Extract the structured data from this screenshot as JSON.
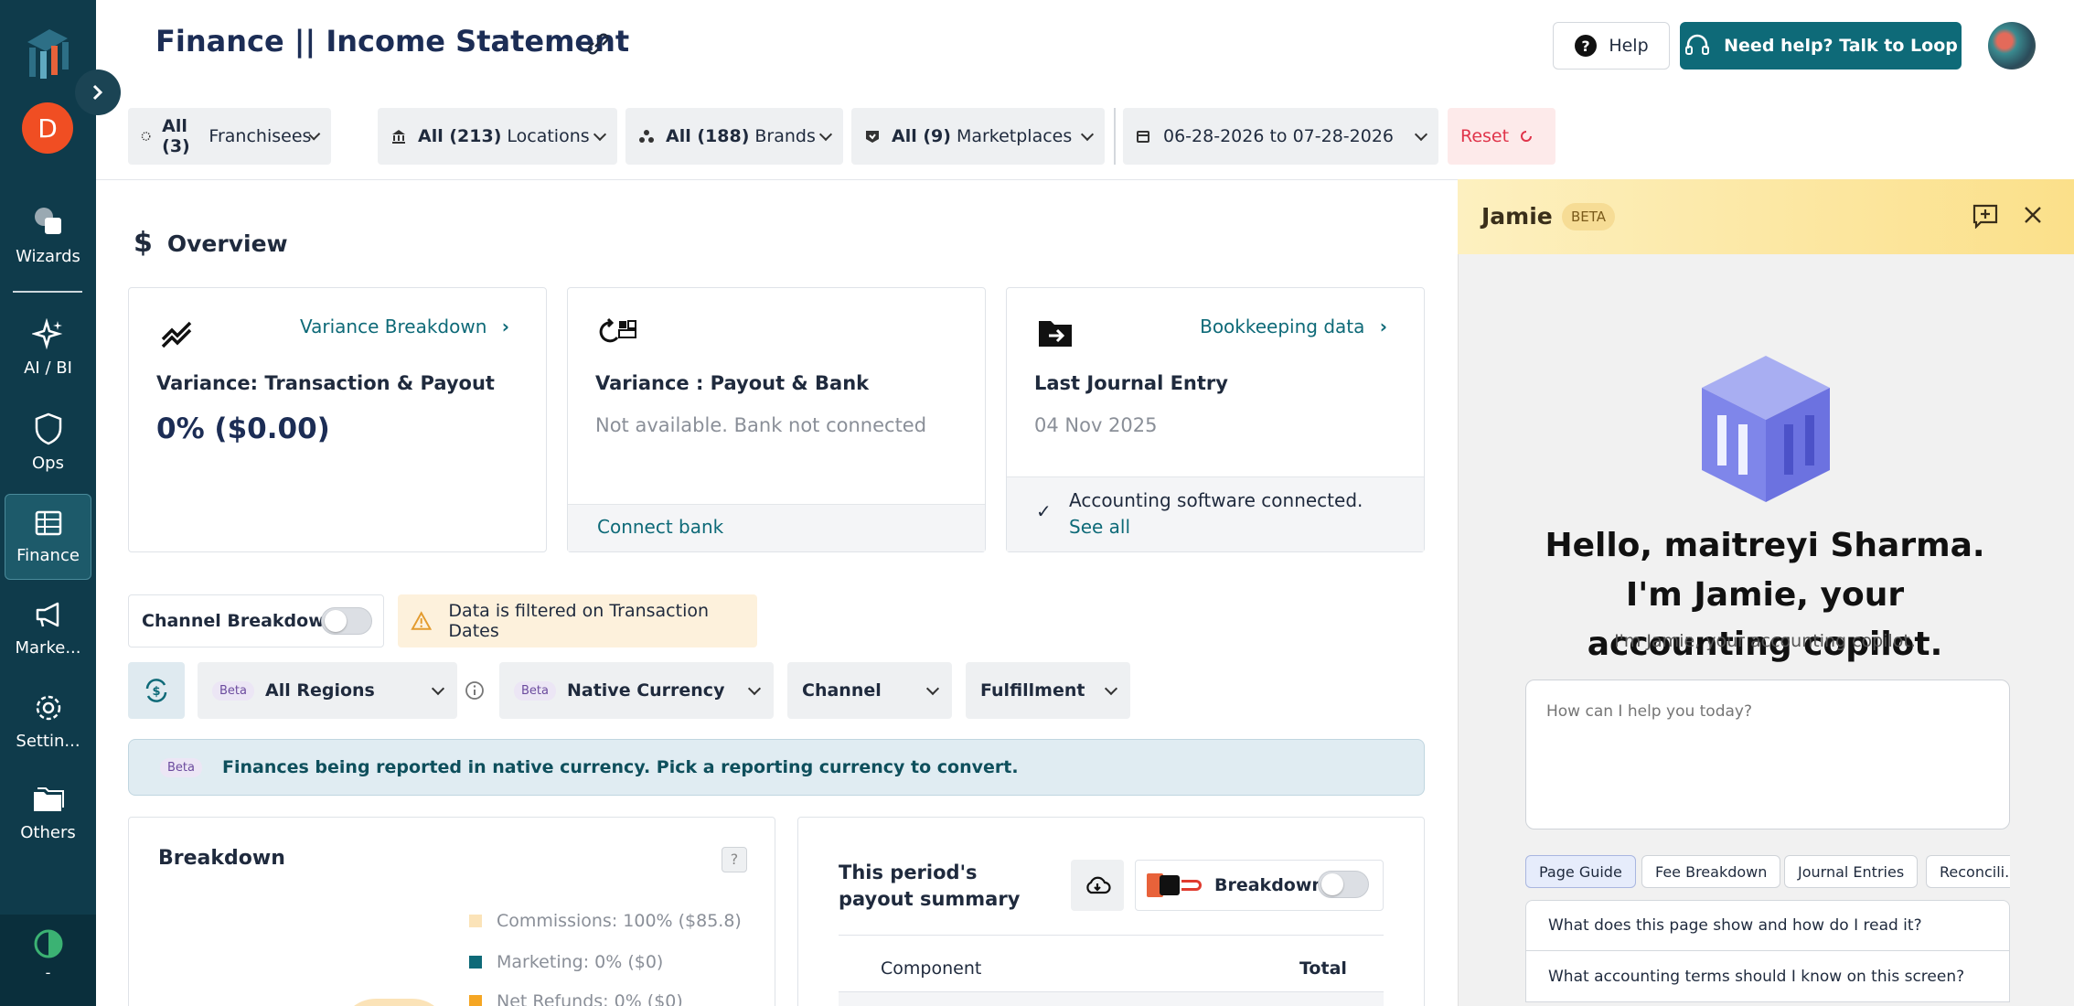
{
  "sidebar": {
    "user_initial": "D",
    "items": [
      {
        "label": "Wizards",
        "icon": "wizards-icon"
      },
      {
        "label": "AI / BI",
        "icon": "sparkle-icon"
      },
      {
        "label": "Ops",
        "icon": "shield-icon"
      },
      {
        "label": "Finance",
        "icon": "table-icon"
      },
      {
        "label": "Marke...",
        "icon": "megaphone-icon"
      },
      {
        "label": "Settin...",
        "icon": "gear-icon"
      },
      {
        "label": "Others",
        "icon": "folder-icon"
      }
    ],
    "bottom_label": "-"
  },
  "header": {
    "title": "Finance || Income Statement",
    "help_label": "Help",
    "talk_label": "Need help? Talk to Loop"
  },
  "filters": {
    "franchisees_count": "All (3)",
    "franchisees_label": "Franchisees",
    "locations_count": "All (213)",
    "locations_label": "Locations",
    "brands_count": "All (188)",
    "brands_label": "Brands",
    "marketplaces_count": "All (9)",
    "marketplaces_label": "Marketplaces",
    "date_range": "06-28-2026 to 07-28-2026",
    "reset_label": "Reset"
  },
  "overview": {
    "title": "Overview",
    "card1": {
      "link": "Variance Breakdown",
      "title": "Variance: Transaction & Payout",
      "value": "0% ($0.00)"
    },
    "card2": {
      "title": "Variance : Payout & Bank",
      "subtitle": "Not available. Bank not connected",
      "action": "Connect bank"
    },
    "card3": {
      "link": "Bookkeeping data",
      "title": "Last Journal Entry",
      "date": "04 Nov 2025",
      "status": "Accounting software connected.",
      "see_all": "See all"
    }
  },
  "controls": {
    "channel_breakdown": "Channel Breakdown",
    "filter_notice": "Data is filtered on Transaction Dates",
    "beta": "Beta",
    "regions": "All Regions",
    "currency": "Native Currency",
    "channel": "Channel",
    "fulfillment": "Fulfillment",
    "banner_beta": "Beta",
    "banner_text": "Finances being reported in native currency. Pick a reporting currency to convert."
  },
  "breakdown": {
    "title": "Breakdown",
    "legend": [
      {
        "label": "Commissions: 100% ($85.8)",
        "color": "#fbe3b8"
      },
      {
        "label": "Marketing: 0% ($0)",
        "color": "#0e6a78"
      },
      {
        "label": "Net Refunds: 0% ($0)",
        "color": "#f5a623"
      }
    ]
  },
  "payout": {
    "title_line1": "This period's",
    "title_line2": "payout summary",
    "breakdown_label": "Breakdown",
    "col_component": "Component",
    "col_total": "Total"
  },
  "jamie": {
    "name": "Jamie",
    "badge": "BETA",
    "greeting": "Hello, maitreyi Sharma. I'm Jamie, your accounting copilot.",
    "sub": "I'm Jamie, your accounting copilot.",
    "placeholder": "How can I help you today?",
    "chips": [
      "Page Guide",
      "Fee Breakdown",
      "Journal Entries",
      "Reconcili..."
    ],
    "suggestions": [
      "What does this page show and how do I read it?",
      "What accounting terms should I know on this screen?"
    ]
  },
  "colors": {
    "brand": "#0e6a78",
    "sidebar": "#0f3b4b",
    "avatar": "#f04e23",
    "panel_header": "#fbe38a"
  }
}
